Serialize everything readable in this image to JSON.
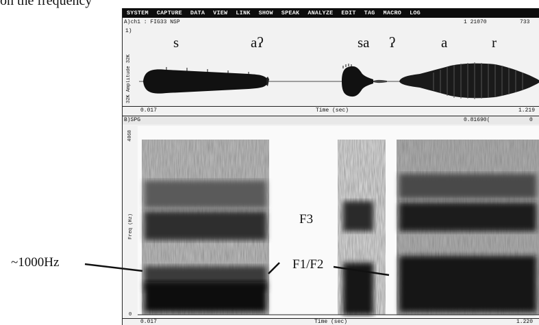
{
  "caption": "on the frequency",
  "menu": [
    "SYSTEM",
    "CAPTURE",
    "DATA",
    "VIEW",
    "LINK",
    "SHOW",
    "SPEAK",
    "ANALYZE",
    "EDIT",
    "TAG",
    "MACRO",
    "LOG"
  ],
  "waveform": {
    "channel_label": "A)ch1 : FIG33 NSP",
    "panel_number": "1)",
    "cursor_value": "1 21070",
    "cursor_value_2": "733",
    "y_axis_label": "Amplitude",
    "y_max": "32K",
    "y_min": "32K",
    "x_start": "0.017",
    "x_label": "Time (sec)",
    "x_end": "1.219"
  },
  "segments": [
    "s",
    "aʔ",
    "sa",
    "ʔ",
    "a",
    "r"
  ],
  "spectrogram": {
    "label": "B)SPG",
    "cursor_value": "0.81690(",
    "cursor_value_2": "0",
    "y_max": "4068",
    "y_axis_label": "Freq (Hz)",
    "y_zero": "0",
    "x_start": "0.017",
    "x_label": "Time (sec)",
    "x_end": "1.220"
  },
  "annotations": {
    "left": "~1000Hz",
    "f3": "F3",
    "f1f2": "F1/F2"
  }
}
